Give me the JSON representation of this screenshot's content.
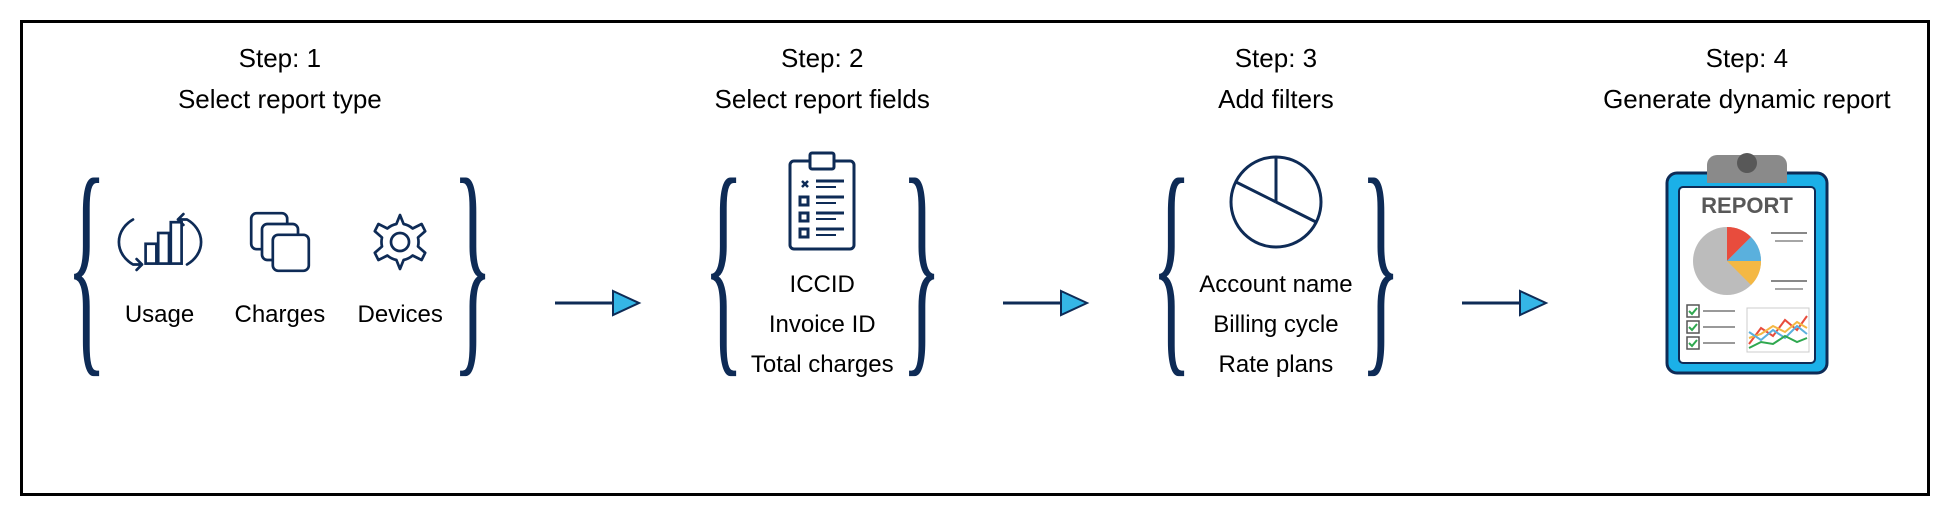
{
  "colors": {
    "stroke": "#0e2b56",
    "arrowStroke": "#0e2b56",
    "arrowFill": "#35b6e6"
  },
  "steps": [
    {
      "title": "Step: 1",
      "subtitle": "Select report type",
      "items": [
        {
          "label": "Usage",
          "icon": "chart-refresh-icon"
        },
        {
          "label": "Charges",
          "icon": "stacked-squares-icon"
        },
        {
          "label": "Devices",
          "icon": "gear-icon"
        }
      ]
    },
    {
      "title": "Step: 2",
      "subtitle": "Select report fields",
      "icon": "clipboard-list-icon",
      "fields": [
        "ICCID",
        "Invoice ID",
        "Total charges"
      ]
    },
    {
      "title": "Step: 3",
      "subtitle": "Add filters",
      "icon": "pie-chart-icon",
      "fields": [
        "Account name",
        "Billing cycle",
        "Rate plans"
      ]
    },
    {
      "title": "Step: 4",
      "subtitle": "Generate dynamic report",
      "icon": "report-clipboard-icon",
      "reportLabel": "REPORT"
    }
  ]
}
